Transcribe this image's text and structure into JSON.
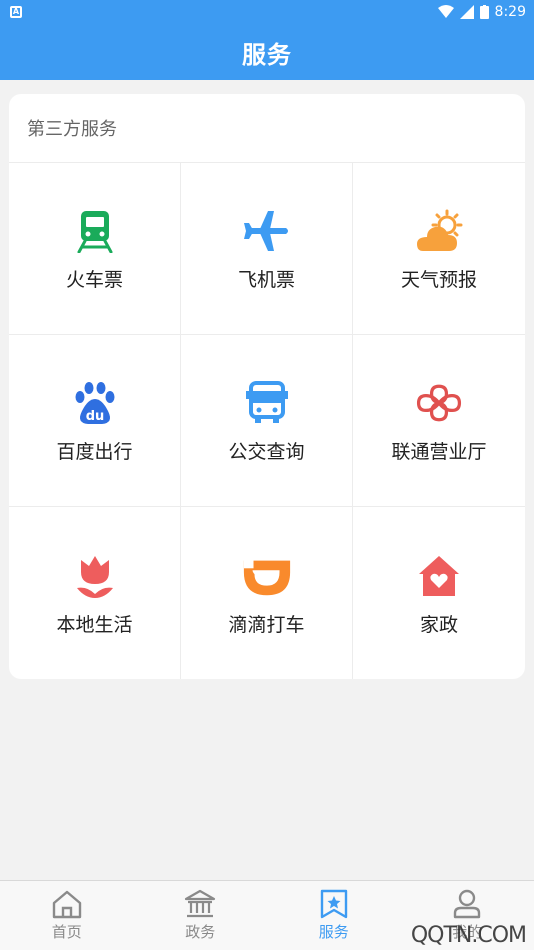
{
  "status_bar": {
    "time": "8:29"
  },
  "header": {
    "title": "服务"
  },
  "section": {
    "title": "第三方服务"
  },
  "services": [
    {
      "label": "火车票",
      "icon": "train-icon",
      "color": "#1aab5a"
    },
    {
      "label": "飞机票",
      "icon": "airplane-icon",
      "color": "#3d9bf2"
    },
    {
      "label": "天气预报",
      "icon": "weather-icon",
      "color": "#f7a13c"
    },
    {
      "label": "百度出行",
      "icon": "baidu-icon",
      "color": "#2f6fe0"
    },
    {
      "label": "公交查询",
      "icon": "bus-icon",
      "color": "#3d9bf2"
    },
    {
      "label": "联通营业厅",
      "icon": "unicom-icon",
      "color": "#e0514f"
    },
    {
      "label": "本地生活",
      "icon": "tulip-icon",
      "color": "#ee5d5d"
    },
    {
      "label": "滴滴打车",
      "icon": "didi-icon",
      "color": "#f98a2c"
    },
    {
      "label": "家政",
      "icon": "home-heart-icon",
      "color": "#ee5d5d"
    }
  ],
  "bottom_nav": [
    {
      "label": "首页",
      "icon": "home-icon",
      "active": false
    },
    {
      "label": "政务",
      "icon": "government-icon",
      "active": false
    },
    {
      "label": "服务",
      "icon": "bookmark-star-icon",
      "active": true
    },
    {
      "label": "我的",
      "icon": "person-icon",
      "active": false
    }
  ],
  "watermark": {
    "text": "QQTN.COM"
  }
}
